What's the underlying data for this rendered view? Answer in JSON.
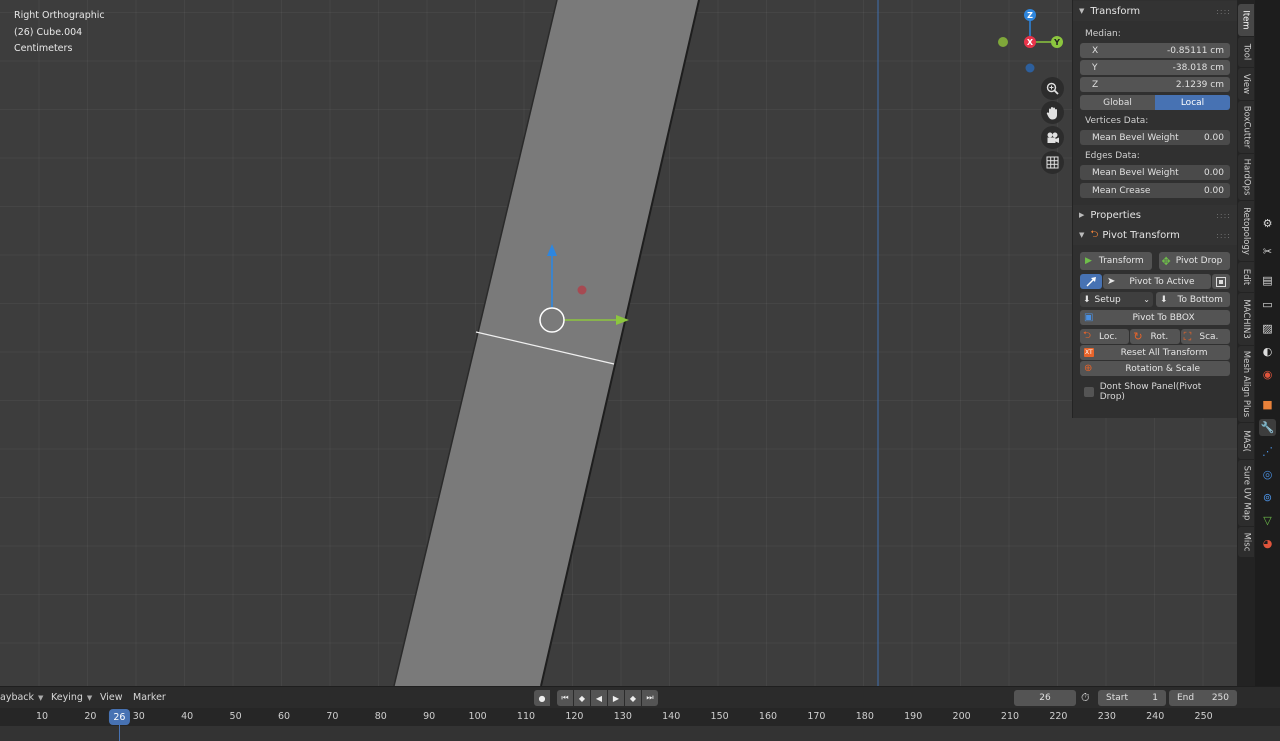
{
  "viewport": {
    "view_name": "Right Orthographic",
    "object_label": "(26) Cube.004",
    "units": "Centimeters",
    "gizmo": {
      "z": "Z",
      "x": "X",
      "y": "Y"
    },
    "nav_icons": [
      "zoom-icon",
      "hand-pan-icon",
      "camera-icon",
      "grid-icon"
    ]
  },
  "npanel": {
    "transform": {
      "title": "Transform",
      "median_label": "Median:",
      "x_label": "X",
      "x_value": "-0.85111 cm",
      "y_label": "Y",
      "y_value": "-38.018 cm",
      "z_label": "Z",
      "z_value": "2.1239 cm",
      "global": "Global",
      "local": "Local",
      "vertices_data_label": "Vertices Data:",
      "vertex_bevel_label": "Mean Bevel Weight",
      "vertex_bevel_value": "0.00",
      "edges_data_label": "Edges Data:",
      "edge_bevel_label": "Mean Bevel Weight",
      "edge_bevel_value": "0.00",
      "crease_label": "Mean Crease",
      "crease_value": "0.00"
    },
    "properties": {
      "title": "Properties"
    },
    "pivot": {
      "title": "Pivot Transform",
      "transform_btn": "Transform",
      "pivot_drop_btn": "Pivot Drop",
      "pivot_to_active": "Pivot To Active",
      "setup": "Setup",
      "to_bottom": "To Bottom",
      "pivot_to_bbox": "Pivot To BBOX",
      "loc": "Loc.",
      "rot": "Rot.",
      "sca": "Sca.",
      "reset_all": "Reset All Transform",
      "rot_scale": "Rotation & Scale",
      "dont_show": "Dont Show Panel(Pivot Drop)"
    }
  },
  "vtabs": [
    "Item",
    "Tool",
    "View",
    "BoxCutter",
    "HardOps",
    "Retopology",
    "Edit",
    "MACHIN3",
    "Mesh Align Plus",
    "MAS(",
    "Sure UV Map",
    "Misc"
  ],
  "timeline": {
    "menus": {
      "playback": "ayback",
      "keying": "Keying",
      "view": "View",
      "marker": "Marker"
    },
    "current_frame": "26",
    "start_label": "Start",
    "start_value": "1",
    "end_label": "End",
    "end_value": "250",
    "ticks": [
      "10",
      "20",
      "30",
      "40",
      "50",
      "60",
      "70",
      "80",
      "90",
      "100",
      "110",
      "120",
      "130",
      "140",
      "150",
      "160",
      "170",
      "180",
      "190",
      "200",
      "210",
      "220",
      "230",
      "240",
      "250"
    ],
    "badge": "26"
  },
  "colors": {
    "accent": "#4772b3",
    "x_axis": "#e8344a",
    "y_axis": "#8cc63e",
    "z_axis": "#2e86de"
  }
}
